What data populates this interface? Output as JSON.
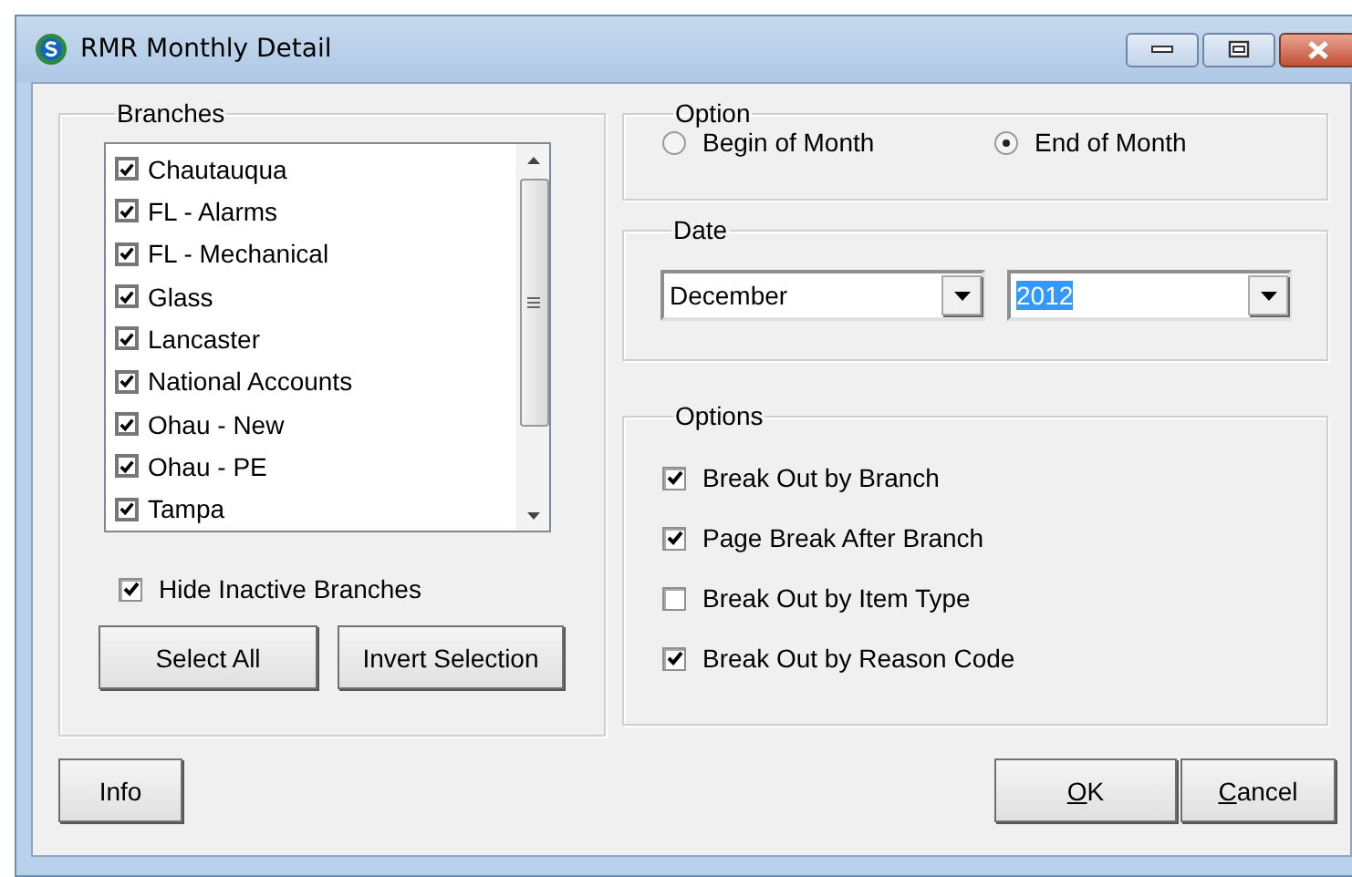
{
  "window": {
    "title": "RMR Monthly Detail"
  },
  "branches": {
    "label": "Branches",
    "items": [
      {
        "label": "Chautauqua",
        "checked": true
      },
      {
        "label": "FL - Alarms",
        "checked": true
      },
      {
        "label": "FL - Mechanical",
        "checked": true
      },
      {
        "label": "Glass",
        "checked": true
      },
      {
        "label": "Lancaster",
        "checked": true
      },
      {
        "label": "National Accounts",
        "checked": true
      },
      {
        "label": "Ohau - New",
        "checked": true
      },
      {
        "label": "Ohau - PE",
        "checked": true
      },
      {
        "label": "Tampa",
        "checked": true
      }
    ],
    "hide_inactive": {
      "label": "Hide Inactive Branches",
      "checked": true
    },
    "buttons": [
      "Select All",
      "Invert Selection"
    ]
  },
  "option": {
    "label": "Option",
    "choices": [
      {
        "label": "Begin of Month",
        "selected": false
      },
      {
        "label": "End of Month",
        "selected": true
      }
    ]
  },
  "date": {
    "label": "Date",
    "month": {
      "value": "December",
      "text_selected": false
    },
    "year": {
      "value": "2012",
      "text_selected": true
    }
  },
  "options": {
    "label": "Options",
    "items": [
      {
        "label": "Break Out by Branch",
        "checked": true
      },
      {
        "label": "Page Break After Branch",
        "checked": true
      },
      {
        "label": "Break Out by Item Type",
        "checked": false
      },
      {
        "label": "Break Out by Reason Code",
        "checked": true
      }
    ]
  },
  "footer": {
    "info_button": "Info",
    "ok_button": "OK",
    "cancel_button": "Cancel"
  }
}
